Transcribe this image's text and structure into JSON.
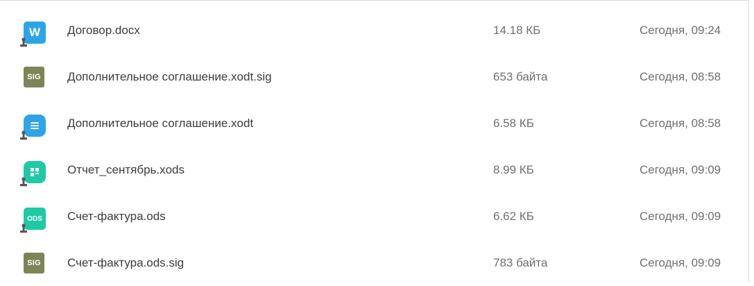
{
  "files": [
    {
      "name": "Договор.docx",
      "size": "14.18 КБ",
      "modified": "Сегодня, 09:24",
      "icon": "word-document-icon",
      "icon_color": "#2ea4e6",
      "icon_glyph": "W",
      "signed_stamp": true
    },
    {
      "name": "Дополнительное соглашение.xodt.sig",
      "size": "653 байта",
      "modified": "Сегодня, 08:58",
      "icon": "signature-file-icon",
      "icon_color": "#7d8558",
      "icon_glyph": "SIG",
      "signed_stamp": false
    },
    {
      "name": "Дополнительное соглашение.xodt",
      "size": "6.58 КБ",
      "modified": "Сегодня, 08:58",
      "icon": "text-document-icon",
      "icon_color": "#2ea4e6",
      "icon_glyph": "",
      "signed_stamp": true
    },
    {
      "name": "Отчет_сентябрь.xods",
      "size": "8.99 КБ",
      "modified": "Сегодня, 09:09",
      "icon": "spreadsheet-icon",
      "icon_color": "#1fc9a4",
      "icon_glyph": "",
      "signed_stamp": true
    },
    {
      "name": "Счет-фактура.ods",
      "size": "6.62 КБ",
      "modified": "Сегодня, 09:09",
      "icon": "ods-spreadsheet-icon",
      "icon_color": "#1fc9a4",
      "icon_glyph": "ODS",
      "signed_stamp": true
    },
    {
      "name": "Счет-фактура.ods.sig",
      "size": "783 байта",
      "modified": "Сегодня, 09:09",
      "icon": "signature-file-icon",
      "icon_color": "#7d8558",
      "icon_glyph": "SIG",
      "signed_stamp": false
    }
  ]
}
